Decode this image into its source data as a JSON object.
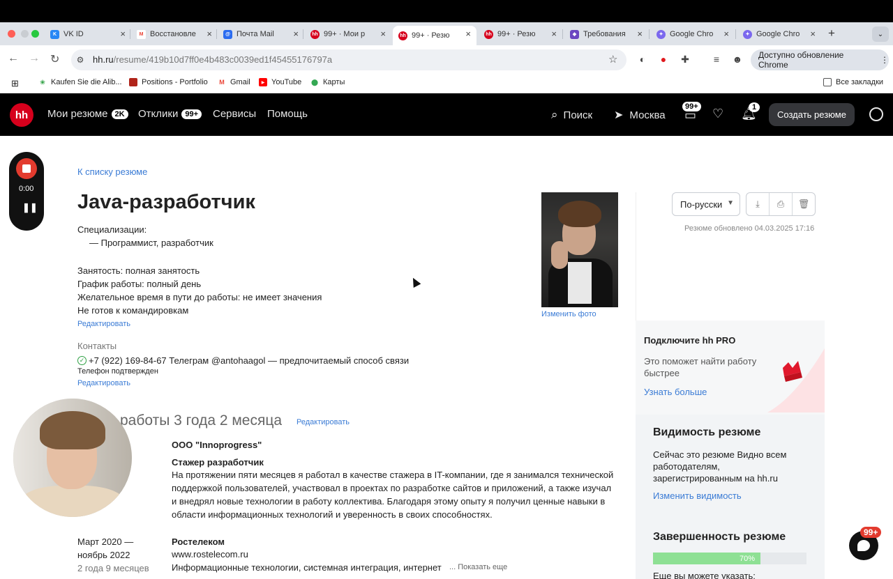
{
  "browser": {
    "tabs": [
      {
        "label": "VK ID",
        "fav_color": "#2787f5",
        "fav_text": "K"
      },
      {
        "label": "Восстановле",
        "fav_color": "#ffffff",
        "fav_text": "M"
      },
      {
        "label": "Почта Mail",
        "fav_color": "#2b6cf0",
        "fav_text": "@"
      },
      {
        "label": "99+ · Мои р",
        "fav_color": "#d6001c",
        "fav_text": "hh"
      },
      {
        "label": "99+ · Резю",
        "fav_color": "#d6001c",
        "fav_text": "hh"
      },
      {
        "label": "99+ · Резю",
        "fav_color": "#d6001c",
        "fav_text": "hh"
      },
      {
        "label": "Требования",
        "fav_color": "#6b46c1",
        "fav_text": "◆"
      },
      {
        "label": "Google Chro",
        "fav_color": "#7b68ee",
        "fav_text": "✦"
      },
      {
        "label": "Google Chro",
        "fav_color": "#7b68ee",
        "fav_text": "✦"
      }
    ],
    "url_host": "hh.ru",
    "url_path": "/resume/419b10d7ff0e4b483c0039ed1f45455176797a",
    "update_label": "Доступно обновление Chrome",
    "bookmarks": [
      {
        "label": "Kaufen Sie die Alib...",
        "color": "#2ea043"
      },
      {
        "label": "Positions - Portfolio",
        "color": "#b0241a"
      },
      {
        "label": "Gmail",
        "color": "#ea4335"
      },
      {
        "label": "YouTube",
        "color": "#ff0000"
      },
      {
        "label": "Карты",
        "color": "#34a853"
      }
    ],
    "all_bookmarks": "Все закладки"
  },
  "hh": {
    "logo": "hh",
    "nav": [
      {
        "label": "Мои резюме",
        "badge": "2K"
      },
      {
        "label": "Отклики",
        "badge": "99+"
      },
      {
        "label": "Сервисы",
        "badge": ""
      },
      {
        "label": "Помощь",
        "badge": ""
      }
    ],
    "search": "Поиск",
    "city": "Москва",
    "messages_badge": "99+",
    "notifications_badge": "1",
    "create_resume": "Создать резюме"
  },
  "resume": {
    "back_link": "К списку резюме",
    "title": "Java-разработчик",
    "spec_label": "Специализации:",
    "spec_item": "— Программист, разработчик",
    "employment": "Занятость: полная занятость",
    "schedule": "График работы: полный день",
    "commute": "Желательное время в пути до работы: не имеет значения",
    "trips": "Не готов к командировкам",
    "edit": "Редактировать",
    "contacts_label": "Контакты",
    "phone_line": "+7 (922) 169-84-67 Телеграм @antohaagol — предпочитаемый способ связи",
    "phone_verified": "Телефон подтвержден",
    "change_photo": "Изменить фото",
    "experience_title": "работы 3 года 2 месяца",
    "exp1": {
      "company": "ООО \"Innoprogress\"",
      "position": "Стажер разработчик",
      "desc": [
        "На протяжении пяти месяцев я работал в качестве стажера в IT-компании, где я занимался технической",
        "поддержкой пользователей, участвовал в проектах по разработке сайтов и приложений, а также изучал",
        "и внедрял новые технологии в работу коллектива. Благодаря этому опыту я получил ценные навыки в",
        "области информационных технологий и уверенность в своих способностях."
      ]
    },
    "exp2": {
      "period1": "Март 2020 —",
      "period2": "ноябрь 2022",
      "duration": "2 года 9 месяцев",
      "company": "Ростелеком",
      "site": "www.rostelecom.ru",
      "industry": "Информационные технологии, системная интеграция, интернет",
      "show_more": "... Показать еще"
    }
  },
  "aside": {
    "lang": "По-русски",
    "updated": "Резюме обновлено 04.03.2025 17:16",
    "pro_title": "Подключите hh PRO",
    "pro_text1": "Это поможет найти работу",
    "pro_text2": "быстрее",
    "pro_link": "Узнать больше",
    "vis_title": "Видимость резюме",
    "vis_text1": "Сейчас это резюме Видно всем",
    "vis_text2": "работодателям,",
    "vis_text3": "зарегистрированным на hh.ru",
    "vis_link": "Изменить видимость",
    "complete_title": "Завершенность резюме",
    "complete_value": "70%",
    "complete_fraction": 0.7,
    "more_text": "Еще вы можете указать:"
  },
  "recorder": {
    "time": "0:00"
  },
  "chat_badge": "99+"
}
